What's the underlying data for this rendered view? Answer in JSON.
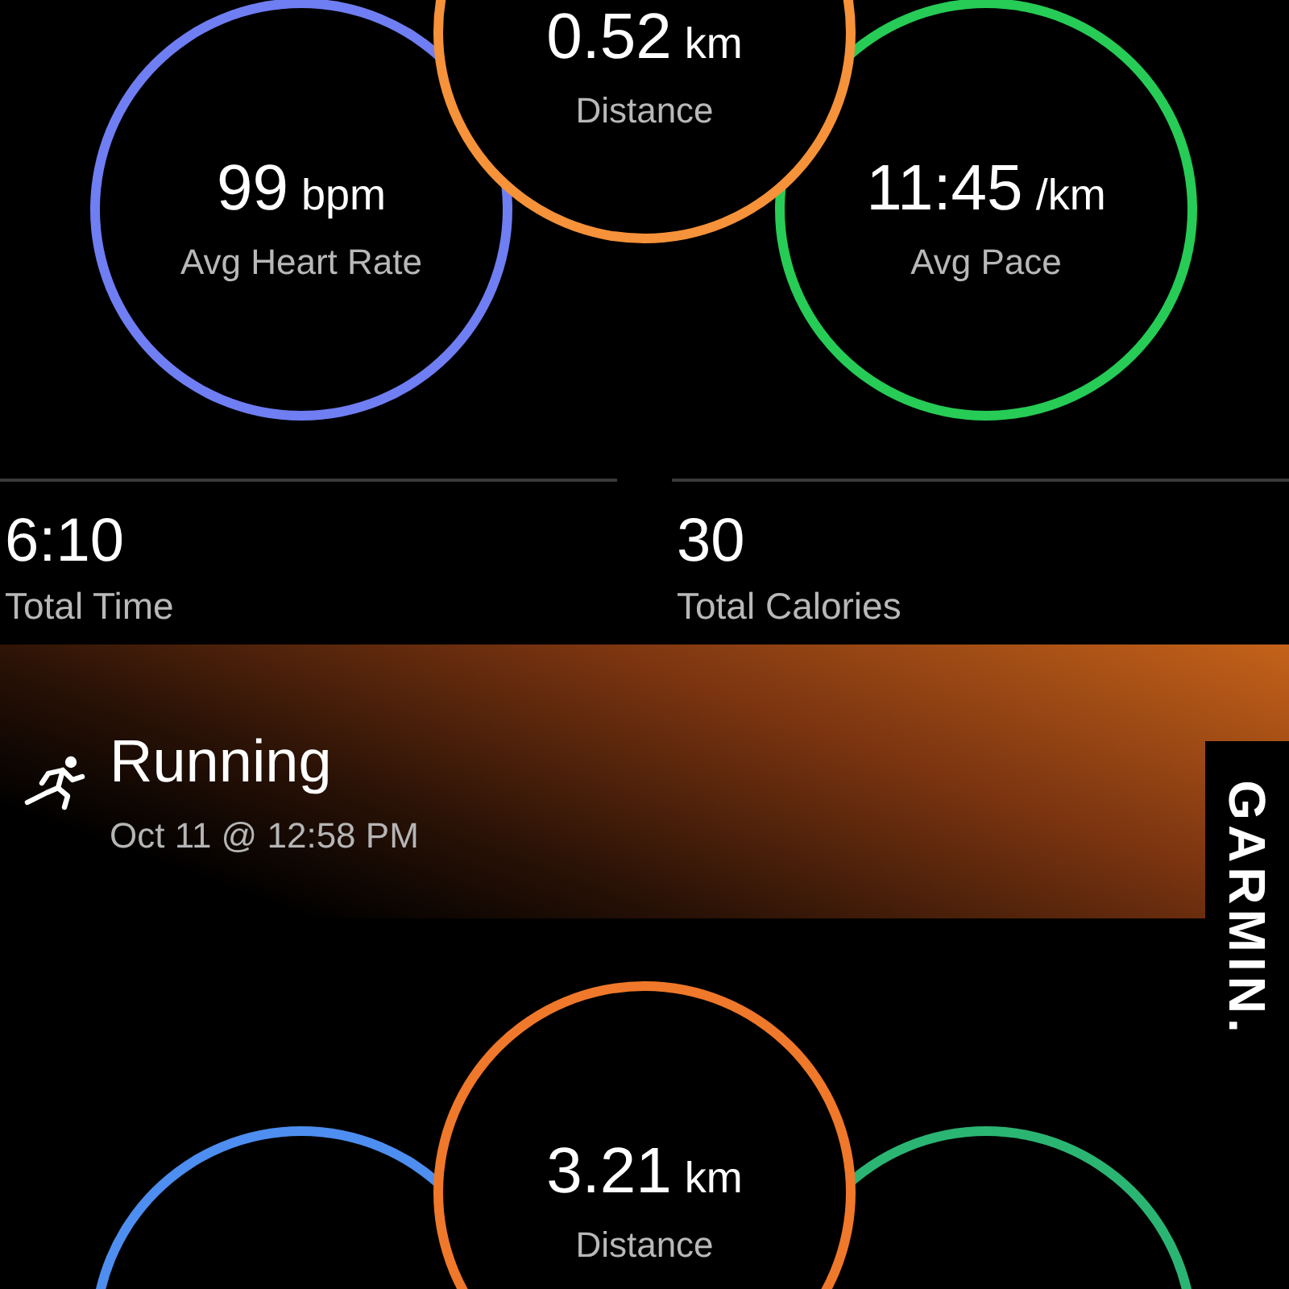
{
  "top_rings": [
    {
      "value": "99",
      "unit": "bpm",
      "label": "Avg Heart Rate",
      "color": "#6f7ef3"
    },
    {
      "value": "0.52",
      "unit": "km",
      "label": "Distance",
      "color": "#f5923a"
    },
    {
      "value": "11:45",
      "unit": "/km",
      "label": "Avg Pace",
      "color": "#26cc55"
    }
  ],
  "stats": [
    {
      "value": "6:10",
      "label": "Total Time"
    },
    {
      "value": "30",
      "label": "Total Calories"
    }
  ],
  "activity": {
    "title": "Running",
    "datetime": "Oct 11 @ 12:58 PM"
  },
  "brand": "GARMIN.",
  "bottom_rings": [
    {
      "color": "#4d8ef0"
    },
    {
      "value": "3.21",
      "unit": "km",
      "label": "Distance",
      "color": "#f0782a"
    },
    {
      "color": "#2bb573"
    }
  ]
}
